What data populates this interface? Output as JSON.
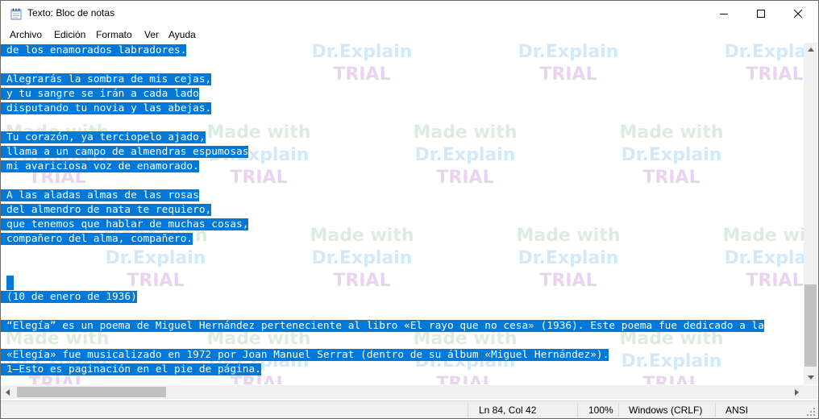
{
  "window": {
    "title": "Texto: Bloc de notas"
  },
  "menu": [
    {
      "label": "Archivo"
    },
    {
      "label": "Edición"
    },
    {
      "label": "Formato"
    },
    {
      "label": "Ver"
    },
    {
      "label": "Ayuda"
    }
  ],
  "editor": {
    "lines": [
      "de los enamorados labradores.",
      "",
      "Alegrarás la sombra de mis cejas,",
      "y tu sangre se irán a cada lado",
      "disputando tu novia y las abejas.",
      "",
      "Tu corazón, ya terciopelo ajado,",
      "llama a un campo de almendras espumosas",
      "mi avariciosa voz de enamorado.",
      "",
      "A las aladas almas de las rosas",
      "del almendro de nata te requiero,",
      "que tenemos que hablar de muchas cosas,",
      "compañero del alma, compañero.",
      "",
      "",
      "",
      "(10 de enero de 1936)",
      "",
      "“Elegía” es un poema de Miguel Hernández perteneciente al libro «El rayo que no cesa» (1936). Este poema fue dedicado a la",
      "",
      "«Elegía» fue musicalizado en 1972 por Joan Manuel Serrat (dentro de su álbum «Miguel Hernández»).",
      "1—Esto es paginación en el pie de página."
    ]
  },
  "watermark": {
    "line1": "Made with",
    "line2": "Dr.Explain",
    "line3": "TRIAL"
  },
  "status": {
    "position": "Ln 84, Col 42",
    "zoom": "100%",
    "line_ending": "Windows (CRLF)",
    "encoding": "ANSI"
  },
  "colors": {
    "selection": "#0078d7",
    "selection_text": "#ffffff"
  }
}
